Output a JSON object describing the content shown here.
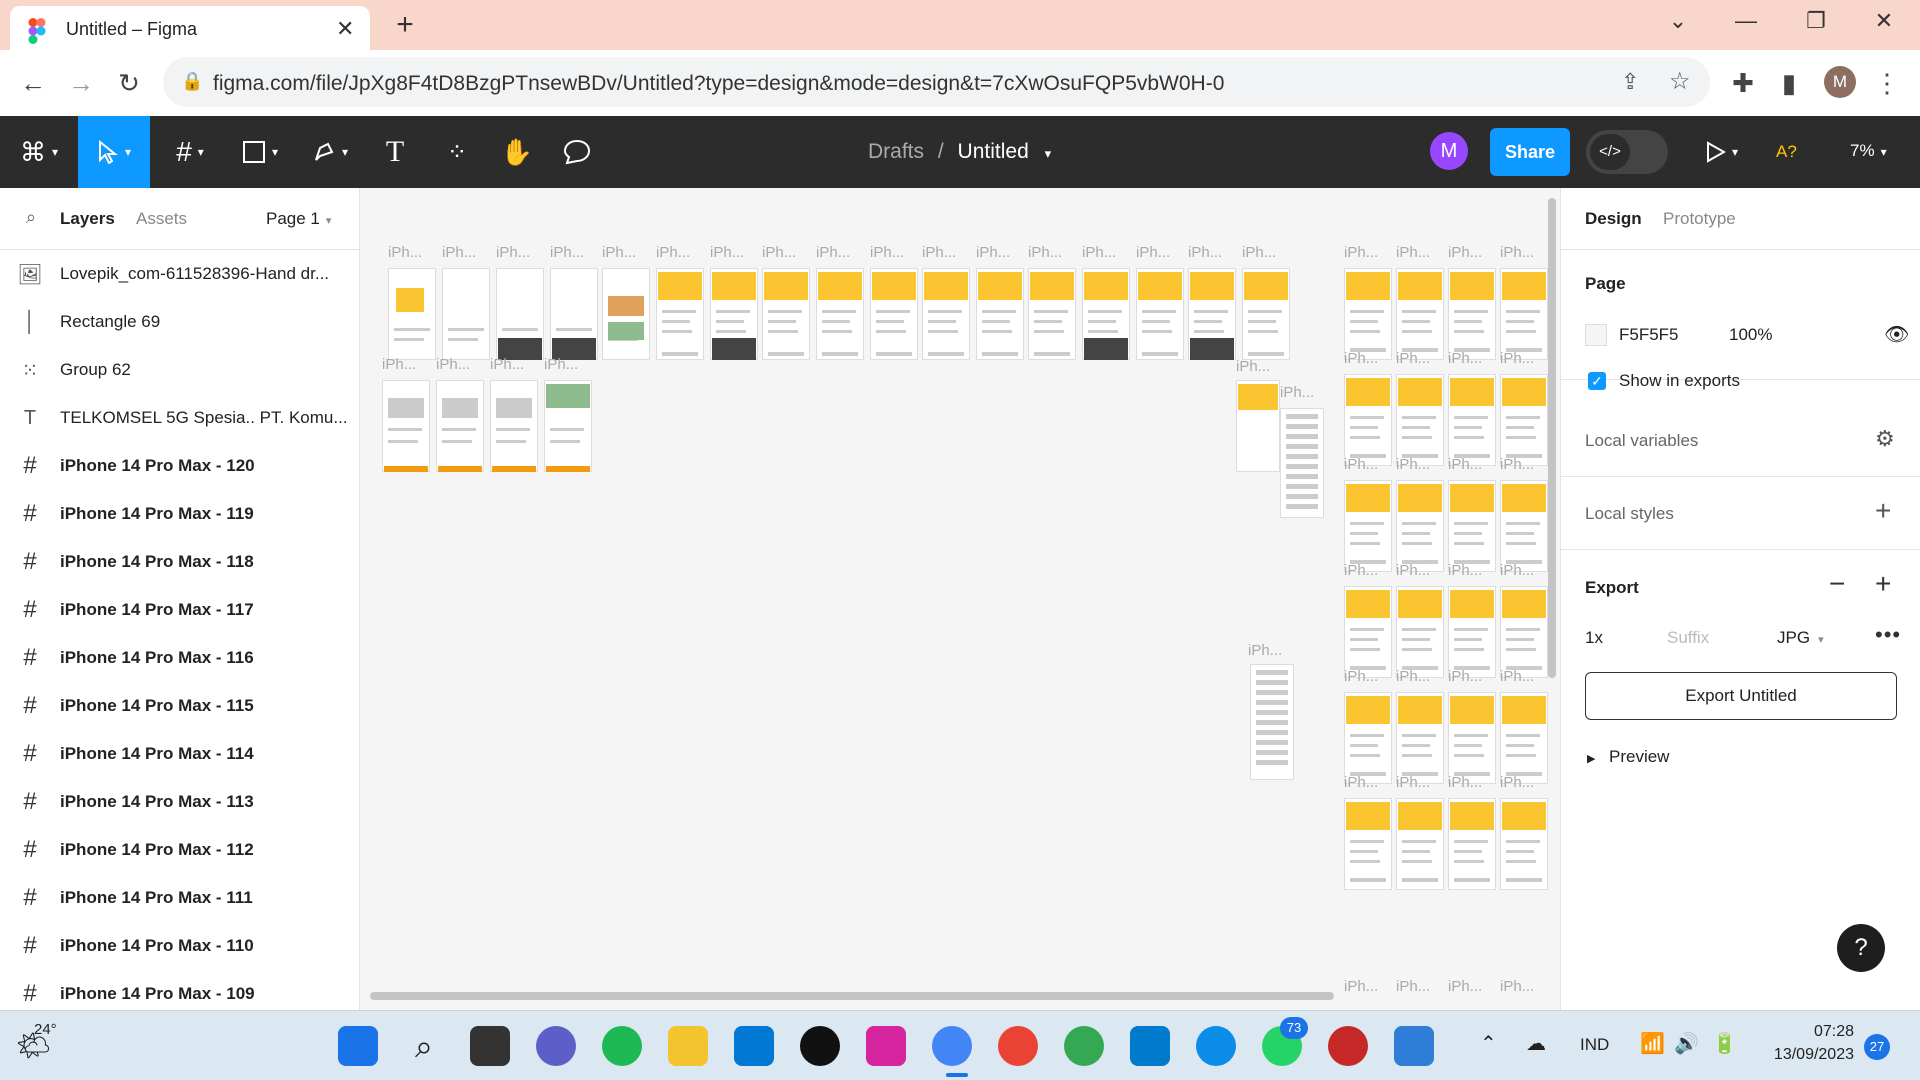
{
  "browser": {
    "tab_title": "Untitled – Figma",
    "url": "figma.com/file/JpXg8F4tD8BzgPTnsewBDv/Untitled?type=design&mode=design&t=7cXwOsuFQP5vbW0H-0",
    "profile_initial": "M"
  },
  "toolbar": {
    "breadcrumb_parent": "Drafts",
    "breadcrumb_sep": "/",
    "file_name": "Untitled",
    "user_initial": "M",
    "share_label": "Share",
    "code_label": "</>",
    "a_label": "A?",
    "zoom": "7%"
  },
  "left_panel": {
    "tab_layers": "Layers",
    "tab_assets": "Assets",
    "page_select": "Page 1",
    "layers": [
      {
        "name": "Lovepik_com-611528396-Hand dr...",
        "icon": "image-icon",
        "bold": false
      },
      {
        "name": "Rectangle 69",
        "icon": "rectangle-icon",
        "bold": false
      },
      {
        "name": "Group 62",
        "icon": "group-icon",
        "bold": false
      },
      {
        "name": "TELKOMSEL 5G Spesia.. PT. Komu...",
        "icon": "text-icon",
        "bold": false
      },
      {
        "name": "iPhone 14 Pro Max - 120",
        "icon": "frame-icon",
        "bold": true
      },
      {
        "name": "iPhone 14 Pro Max - 119",
        "icon": "frame-icon",
        "bold": true
      },
      {
        "name": "iPhone 14 Pro Max - 118",
        "icon": "frame-icon",
        "bold": true
      },
      {
        "name": "iPhone 14 Pro Max - 117",
        "icon": "frame-icon",
        "bold": true
      },
      {
        "name": "iPhone 14 Pro Max - 116",
        "icon": "frame-icon",
        "bold": true
      },
      {
        "name": "iPhone 14 Pro Max - 115",
        "icon": "frame-icon",
        "bold": true
      },
      {
        "name": "iPhone 14 Pro Max - 114",
        "icon": "frame-icon",
        "bold": true
      },
      {
        "name": "iPhone 14 Pro Max - 113",
        "icon": "frame-icon",
        "bold": true
      },
      {
        "name": "iPhone 14 Pro Max - 112",
        "icon": "frame-icon",
        "bold": true
      },
      {
        "name": "iPhone 14 Pro Max - 111",
        "icon": "frame-icon",
        "bold": true
      },
      {
        "name": "iPhone 14 Pro Max - 110",
        "icon": "frame-icon",
        "bold": true
      },
      {
        "name": "iPhone 14 Pro Max - 109",
        "icon": "frame-icon",
        "bold": true
      }
    ]
  },
  "canvas": {
    "frame_label": "iPh...",
    "background": "#F5F5F5"
  },
  "right_panel": {
    "tab_design": "Design",
    "tab_prototype": "Prototype",
    "page_heading": "Page",
    "page_color": "F5F5F5",
    "page_opacity": "100%",
    "show_in_exports": "Show in exports",
    "local_variables": "Local variables",
    "local_styles": "Local styles",
    "export_heading": "Export",
    "export_scale": "1x",
    "export_suffix_placeholder": "Suffix",
    "export_format": "JPG",
    "export_button": "Export Untitled",
    "preview": "Preview",
    "help": "?"
  },
  "taskbar": {
    "weather_temp": "24°",
    "language": "IND",
    "time": "07:28",
    "date": "13/09/2023",
    "notification_count": "27",
    "whatsapp_badge": "73"
  },
  "colors": {
    "tab_bar": "#f8d6c9",
    "figma_toolbar": "#2c2c2c",
    "accent": "#0d99ff",
    "avatar": "#9747ff",
    "taskbar": "#dce8f1"
  }
}
